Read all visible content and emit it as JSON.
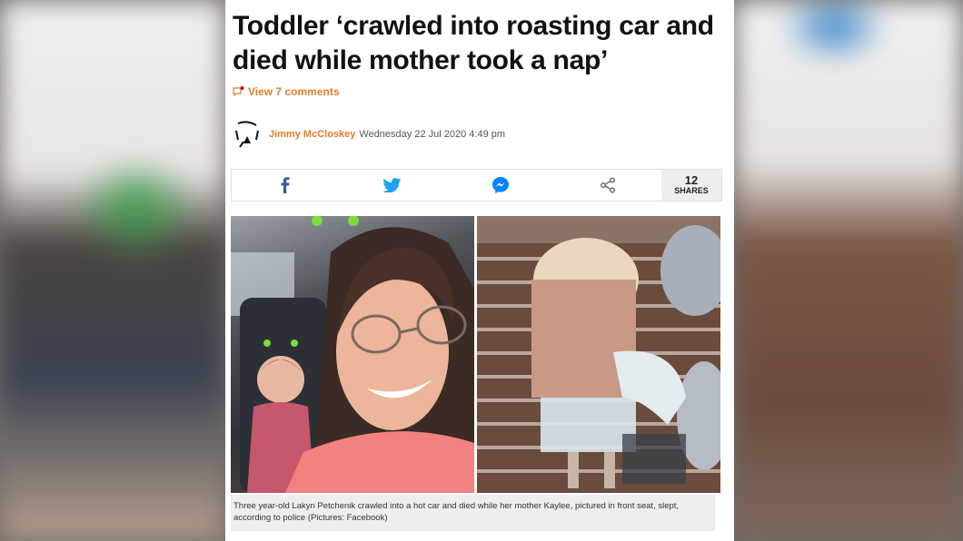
{
  "article": {
    "headline": "Toddler ‘crawled into roasting car and died while mother took a nap’",
    "comments_link": "View 7 comments",
    "author": "Jimmy McCloskey",
    "published": "Wednesday 22 Jul 2020 4:49 pm",
    "share": {
      "count": "12",
      "count_label": "SHARES",
      "buttons": [
        {
          "icon": "facebook-icon",
          "color": "#3b5998"
        },
        {
          "icon": "twitter-icon",
          "color": "#1da1f2"
        },
        {
          "icon": "messenger-icon",
          "color": "#0084ff"
        },
        {
          "icon": "share-icon",
          "color": "#666666"
        }
      ]
    },
    "caption": "Three year-old Lakyn Petchenik crawled into a hot car and died while her mother Kaylee, pictured in front seat, slept, according to police (Pictures: Facebook)"
  },
  "colors": {
    "accent": "#e07d2b",
    "headline": "#111111",
    "caption_bg": "#eeeeee"
  }
}
